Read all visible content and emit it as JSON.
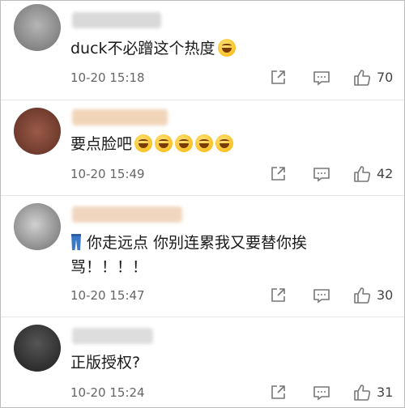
{
  "comments": [
    {
      "text": "duck不必蹭这个热度",
      "emoji_count": 1,
      "time": "10-20 15:18",
      "likes": "70",
      "avatar_color": "#8a8a8a",
      "name_color": "#d7d7d7"
    },
    {
      "text": "要点脸吧",
      "emoji_count": 5,
      "time": "10-20 15:49",
      "likes": "42",
      "avatar_color": "#7a4a3a",
      "name_color": "#f3d9bf"
    },
    {
      "text_line1": "你走远点 你别连累我又要替你挨",
      "text_line2": "骂！！！！",
      "time": "10-20 15:47",
      "likes": "30",
      "avatar_color": "#9a9a9a",
      "name_color": "#f2d8c0"
    },
    {
      "text": "正版授权?",
      "time": "10-20 15:24",
      "likes": "31",
      "avatar_color": "#333333",
      "name_color": "#dedede"
    }
  ],
  "icons": {
    "share": "share-icon",
    "reply": "comment-icon",
    "like": "thumbs-up-icon",
    "prefix": "jeans-emoji"
  }
}
